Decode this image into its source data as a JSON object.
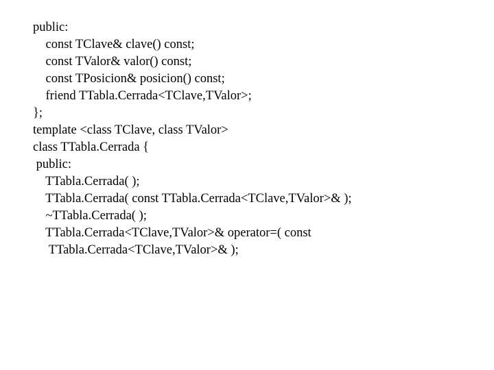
{
  "lines": [
    {
      "text": "public:",
      "indent": 0
    },
    {
      "text": "const TClave& clave() const;",
      "indent": 1
    },
    {
      "text": "const TValor& valor() const;",
      "indent": 1
    },
    {
      "text": "const TPosicion& posicion() const;",
      "indent": 1
    },
    {
      "text": "friend TTabla.Cerrada<TClave,TValor>;",
      "indent": 1
    },
    {
      "text": "};",
      "indent": 0
    },
    {
      "text": "",
      "indent": 0
    },
    {
      "text": "template <class TClave, class TValor>",
      "indent": 0
    },
    {
      "text": "class TTabla.Cerrada {",
      "indent": 0
    },
    {
      "text": " public:",
      "indent": 0
    },
    {
      "text": "",
      "indent": 0
    },
    {
      "text": "TTabla.Cerrada( );",
      "indent": 1
    },
    {
      "text": "TTabla.Cerrada( const TTabla.Cerrada<TClave,TValor>& );",
      "indent": 1
    },
    {
      "text": "~TTabla.Cerrada( );",
      "indent": 1
    },
    {
      "text": "TTabla.Cerrada<TClave,TValor>& operator=( const",
      "indent": 1
    },
    {
      "text": " TTabla.Cerrada<TClave,TValor>& );",
      "indent": 1
    }
  ],
  "indent_unit": "    "
}
